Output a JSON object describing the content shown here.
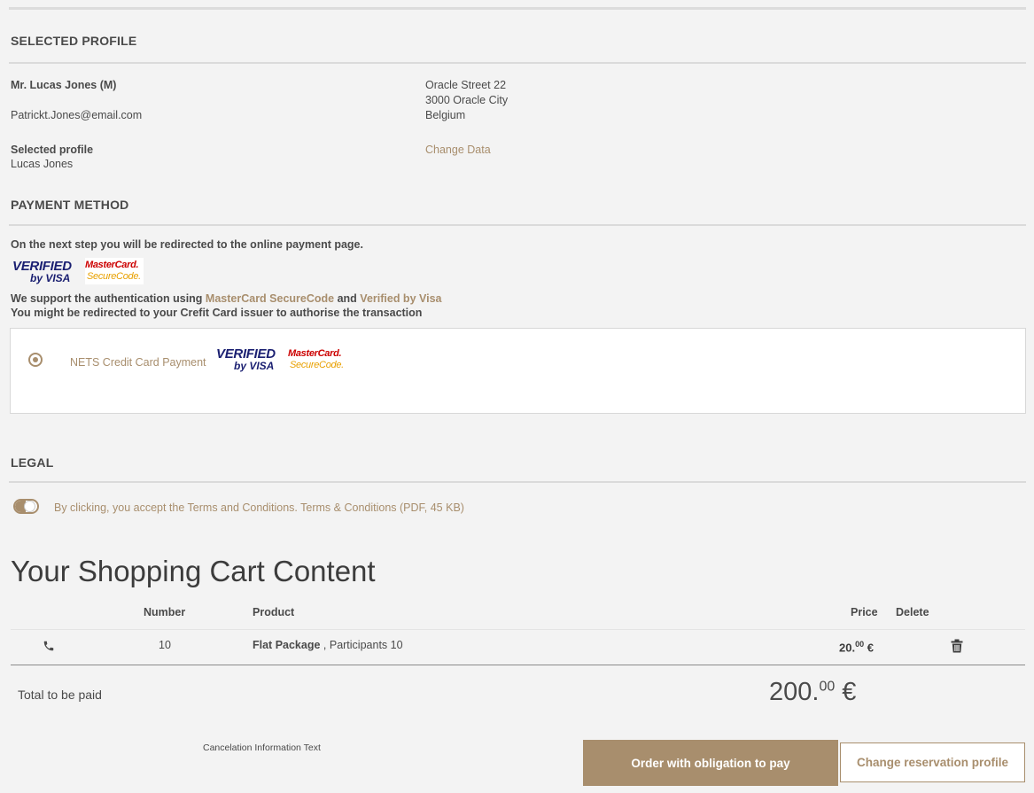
{
  "profile": {
    "title": "SELECTED PROFILE",
    "name": "Mr. Lucas Jones (M)",
    "email": "Patrickt.Jones@email.com",
    "selected_label": "Selected profile",
    "selected_value": "Lucas Jones",
    "address_line1": "Oracle Street 22",
    "address_line2": "3000 Oracle City",
    "address_line3": "Belgium",
    "change_data": "Change Data"
  },
  "payment": {
    "title": "PAYMENT METHOD",
    "redirect_note": "On the next step you will be redirected to the online payment page.",
    "support_prefix": "We support the authentication using ",
    "support_mc": "MasterCard SecureCode",
    "support_and": " and ",
    "support_visa": "Verified by Visa",
    "issuer_note": "You might be redirected to your Crefit Card issuer to authorise the transaction",
    "option_label": "NETS Credit Card Payment",
    "visa_logo_top": "VERIFIED",
    "visa_logo_bottom": "by VISA",
    "mc_logo_top": "MasterCard.",
    "mc_logo_bottom": "SecureCode."
  },
  "legal": {
    "title": "LEGAL",
    "terms_text": "By clicking, you accept the Terms and Conditions. Terms & Conditions (PDF, 45 KB)"
  },
  "cart": {
    "title": "Your Shopping Cart Content",
    "headers": {
      "number": "Number",
      "product": "Product",
      "price": "Price",
      "delete": "Delete"
    },
    "rows": [
      {
        "number": "10",
        "product_name": "Flat Package",
        "product_detail": " , Participants 10",
        "price_main": "20.",
        "price_cents": "00",
        "price_currency": " €"
      }
    ],
    "total_label": "Total to be paid",
    "total_main": "200.",
    "total_cents": "00",
    "total_currency": " €",
    "cancel_info": "Cancelation Information Text",
    "order_button": "Order with obligation to pay",
    "change_profile_button": "Change reservation profile"
  },
  "colors": {
    "accent": "#a88e6d",
    "background": "#f3f3f3"
  }
}
